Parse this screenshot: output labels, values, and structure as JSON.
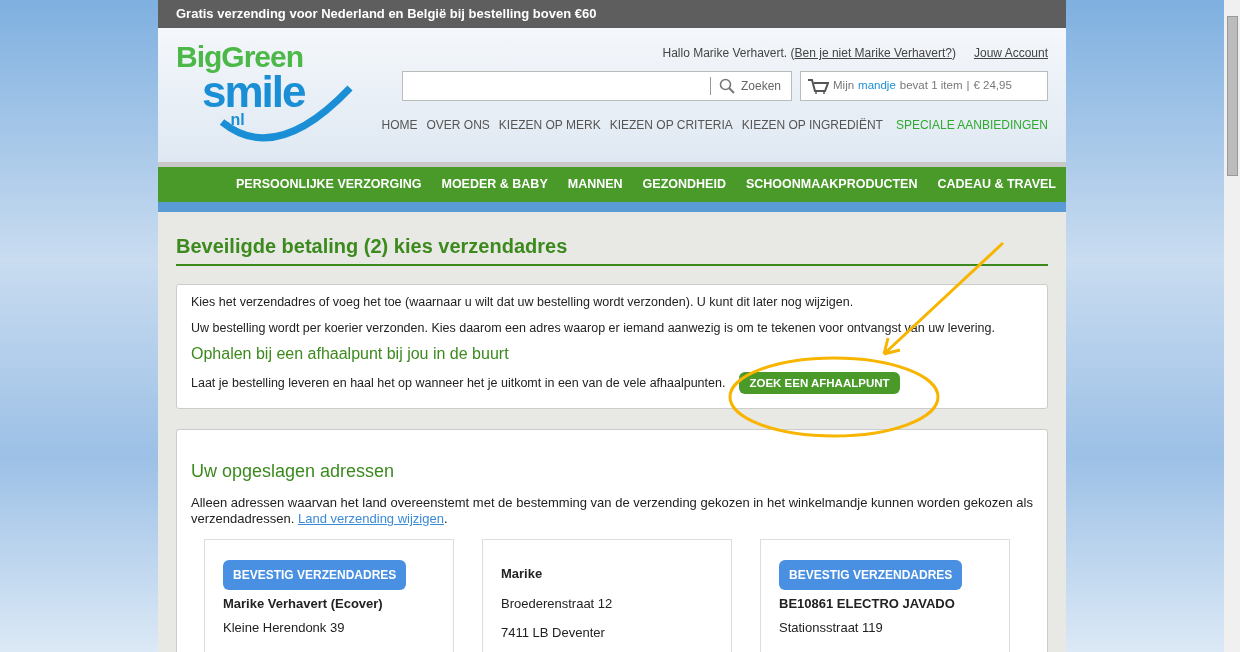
{
  "promo_bar": {
    "text": "Gratis verzending voor Nederland en België bij bestelling boven €60"
  },
  "logo": {
    "line1": "BigGreen",
    "line2": "smile",
    "line3": ".nl"
  },
  "user_bar": {
    "greeting_prefix": "Hallo Marike Verhavert. (",
    "switch_link": "Ben je niet Marike Verhavert?",
    "greeting_suffix": ")",
    "account_link": "Jouw Account"
  },
  "search": {
    "button": "Zoeken"
  },
  "cart": {
    "prefix": "Mijn",
    "link": "mandje",
    "suffix": "bevat 1 item",
    "separator": "|",
    "total": "€ 24,95"
  },
  "top_nav": [
    {
      "label": "HOME",
      "highlight": false
    },
    {
      "label": "OVER ONS",
      "highlight": false
    },
    {
      "label": "KIEZEN OP MERK",
      "highlight": false
    },
    {
      "label": "KIEZEN OP CRITERIA",
      "highlight": false
    },
    {
      "label": "KIEZEN OP INGREDIËNT",
      "highlight": false
    },
    {
      "label": "SPECIALE AANBIEDINGEN",
      "highlight": true
    }
  ],
  "main_nav": [
    "PERSOONLIJKE VERZORGING",
    "MOEDER & BABY",
    "MANNEN",
    "GEZONDHEID",
    "SCHOONMAAKPRODUCTEN",
    "CADEAU & TRAVEL"
  ],
  "page_title": "Beveiligde betaling (2) kies verzendadres",
  "info_box": {
    "paragraphs": [
      "Kies het verzendadres of voeg het toe (waarnaar u wilt dat uw bestelling wordt verzonden). U kunt dit later nog wijzigen.",
      "Uw bestelling wordt per koerier verzonden. Kies daarom een adres waarop er iemand aanwezig is om te tekenen voor ontvangst van uw levering."
    ],
    "pickup_heading": "Ophalen bij een afhaalpunt bij jou in de buurt",
    "pickup_text": "Laat je bestelling leveren en haal het op wanneer het je uitkomt in een van de vele afhaalpunten.",
    "pickup_button": "ZOEK EEN AFHAALPUNT"
  },
  "saved_addresses": {
    "heading": "Uw opgeslagen adressen",
    "text": "Alleen adressen waarvan het land overeenstemt met de bestemming van de verzending gekozen in het winkelmandje kunnen worden gekozen als verzendadressen.",
    "link": "Land verzending wijzigen",
    "link_suffix": ".",
    "cards": [
      {
        "button": "BEVESTIG VERZENDADRES",
        "name": "Marike Verhavert (Ecover)",
        "lines": [
          "Kleine Herendonk 39"
        ]
      },
      {
        "name": "Marike",
        "lines": [
          "Broederenstraat 12",
          "7411 LB Deventer"
        ]
      },
      {
        "button": "BEVESTIG VERZENDADRES",
        "name": "BE10861 ELECTRO JAVADO",
        "lines": [
          "Stationsstraat 119"
        ]
      }
    ]
  }
}
